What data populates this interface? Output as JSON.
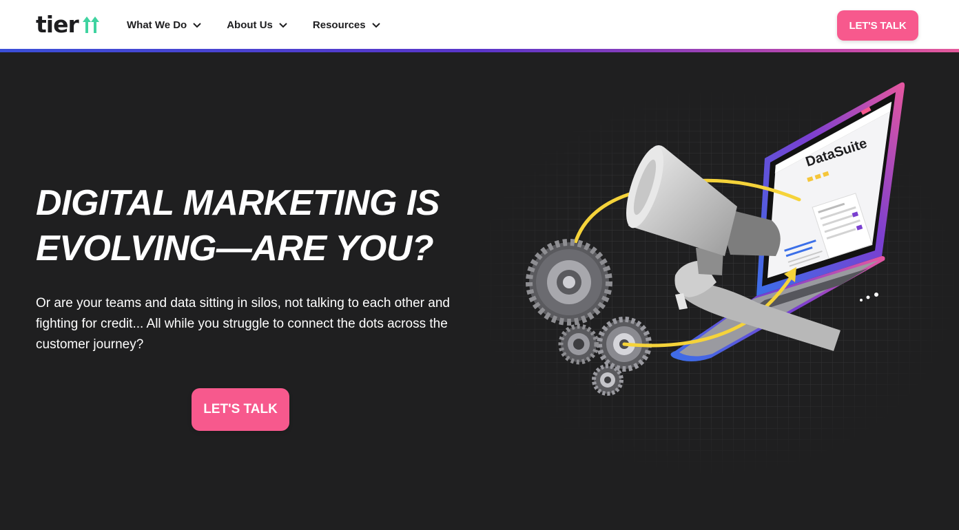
{
  "header": {
    "logo_text": "tier",
    "nav": [
      {
        "label": "What We Do"
      },
      {
        "label": "About Us"
      },
      {
        "label": "Resources"
      }
    ],
    "cta_label": "LET'S TALK"
  },
  "hero": {
    "title_line1": "DIGITAL MARKETING IS",
    "title_line2": "EVOLVING—ARE YOU?",
    "subtitle": "Or are your teams and data sitting in silos, not talking to each other and fighting for credit... All while you struggle to connect the dots across the customer journey?",
    "cta_label": "LET'S TALK"
  },
  "illustration": {
    "screen_brand": "DataSuite",
    "icons": [
      "megaphone-icon",
      "gear-icon",
      "laptop-icon",
      "arrow-icon"
    ]
  },
  "colors": {
    "accent_pink": "#f7598d",
    "logo_green": "#3fd3a0",
    "arrow_yellow": "#f5d33a",
    "background": "#1f1f20"
  }
}
